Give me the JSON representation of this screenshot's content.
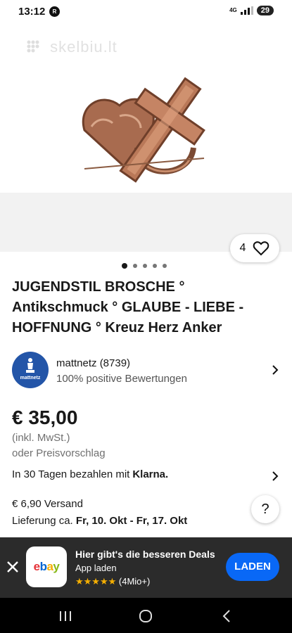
{
  "status_bar": {
    "time": "13:12",
    "notification_badge": "R",
    "network": "4G",
    "battery": "29"
  },
  "gallery": {
    "watermark": "skelbiu.lt",
    "like_count": "4",
    "image_count": 5,
    "active_index": 0
  },
  "listing": {
    "title": "JUGENDSTIL BROSCHE ° Antikschmuck ° GLAUBE - LIEBE - HOFFNUNG ° Kreuz Herz Anker"
  },
  "seller": {
    "logo_text": "mattnetz",
    "name": "mattnetz (8739)",
    "rating": "100% positive Bewertungen"
  },
  "pricing": {
    "price": "€ 35,00",
    "tax_note": "(inkl. MwSt.)",
    "offer_note": "oder Preisvorschlag",
    "klarna_text": "In 30 Tagen bezahlen mit",
    "klarna_brand": "Klarna."
  },
  "shipping": {
    "cost": "€ 6,90 Versand",
    "delivery_prefix": "Lieferung ca.",
    "delivery_dates": "Fr, 10. Okt - Fr, 17. Okt"
  },
  "help_button": "?",
  "app_banner": {
    "title": "Hier gibt's die besseren Deals",
    "subtitle": "App laden",
    "stars": "★★★★★",
    "rating_count": "(4Mio+)",
    "button_label": "LADEN",
    "app_icon": "ebay"
  },
  "colors": {
    "accent_blue": "#0968f6",
    "seller_blue": "#2355a8",
    "banner_bg": "#2b2b2b",
    "star_yellow": "#f5af02"
  }
}
